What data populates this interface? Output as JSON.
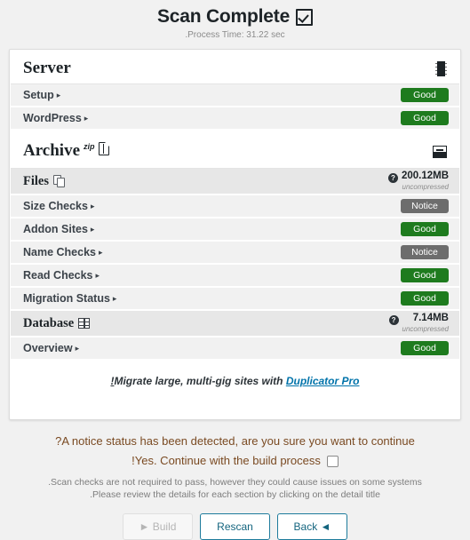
{
  "header": {
    "title": "Scan Complete",
    "status_icon": "checked-checkbox-icon",
    "process_time": ".Process Time: 31.22 sec"
  },
  "colors": {
    "good": "#1e7b1e",
    "notice": "#6d6d6d",
    "link": "#0073aa",
    "warning_text": "#7a4a22",
    "panel_bg": "#ffffff",
    "row_bg": "#f1f1f1",
    "subhead_bg": "#e7e7e7"
  },
  "sections": [
    {
      "title": "Server",
      "icon": "server-chip-icon",
      "rows": [
        {
          "label": "Setup",
          "caret": "▸",
          "badge": "Good",
          "state": "good"
        },
        {
          "label": "WordPress",
          "caret": "▸",
          "badge": "Good",
          "state": "good"
        }
      ]
    },
    {
      "title": "Archive",
      "superscript": "zip",
      "title_icon": "zip-file-icon",
      "icon": "archive-box-icon",
      "subheads": [
        {
          "label": "Files",
          "icon": "files-copy-icon",
          "help_icon": "question-mark-icon",
          "size": "200.12MB",
          "size_note": "uncompressed",
          "rows": [
            {
              "label": "Size Checks",
              "caret": "▸",
              "badge": "Notice",
              "state": "notice"
            },
            {
              "label": "Addon Sites",
              "caret": "▸",
              "badge": "Good",
              "state": "good"
            },
            {
              "label": "Name Checks",
              "caret": "▸",
              "badge": "Notice",
              "state": "notice"
            },
            {
              "label": "Read Checks",
              "caret": "▸",
              "badge": "Good",
              "state": "good"
            },
            {
              "label": "Migration Status",
              "caret": "▸",
              "badge": "Good",
              "state": "good"
            }
          ]
        },
        {
          "label": "Database",
          "icon": "database-table-icon",
          "help_icon": "question-mark-icon",
          "size": "7.14MB",
          "size_note": "uncompressed",
          "rows": [
            {
              "label": "Overview",
              "caret": "▸",
              "badge": "Good",
              "state": "good"
            }
          ]
        }
      ]
    }
  ],
  "promo": {
    "prefix": "!",
    "text": "Migrate large, multi-gig sites with ",
    "link_label": "Duplicator Pro"
  },
  "footer": {
    "warning_line1": "?A notice status has been detected, are you sure you want to continue",
    "warning_line2": "!Yes. Continue with the build process",
    "confirm_checkbox": "build-confirm-checkbox",
    "help_line1": ".Scan checks are not required to pass, however they could cause issues on some systems",
    "help_line2": ".Please review the details for each section by clicking on the detail title",
    "buttons": [
      {
        "label": "► Build",
        "name": "build-button",
        "state": "disabled"
      },
      {
        "label": "Rescan",
        "name": "rescan-button",
        "state": "primary"
      },
      {
        "label": "Back ◄",
        "name": "back-button",
        "state": "primary"
      }
    ]
  }
}
